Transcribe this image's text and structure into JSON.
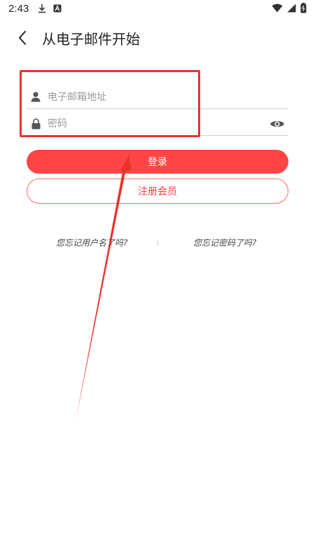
{
  "status_bar": {
    "time": "2:43"
  },
  "header": {
    "title": "从电子邮件开始"
  },
  "form": {
    "email_placeholder": "电子邮箱地址",
    "password_placeholder": "密码"
  },
  "buttons": {
    "login_label": "登录",
    "register_label": "注册会员"
  },
  "links": {
    "forgot_username": "您忘记用户名了吗?",
    "forgot_password": "您忘记密码了吗?"
  },
  "colors": {
    "accent": "#ff4545",
    "annotation": "#e8332b"
  }
}
